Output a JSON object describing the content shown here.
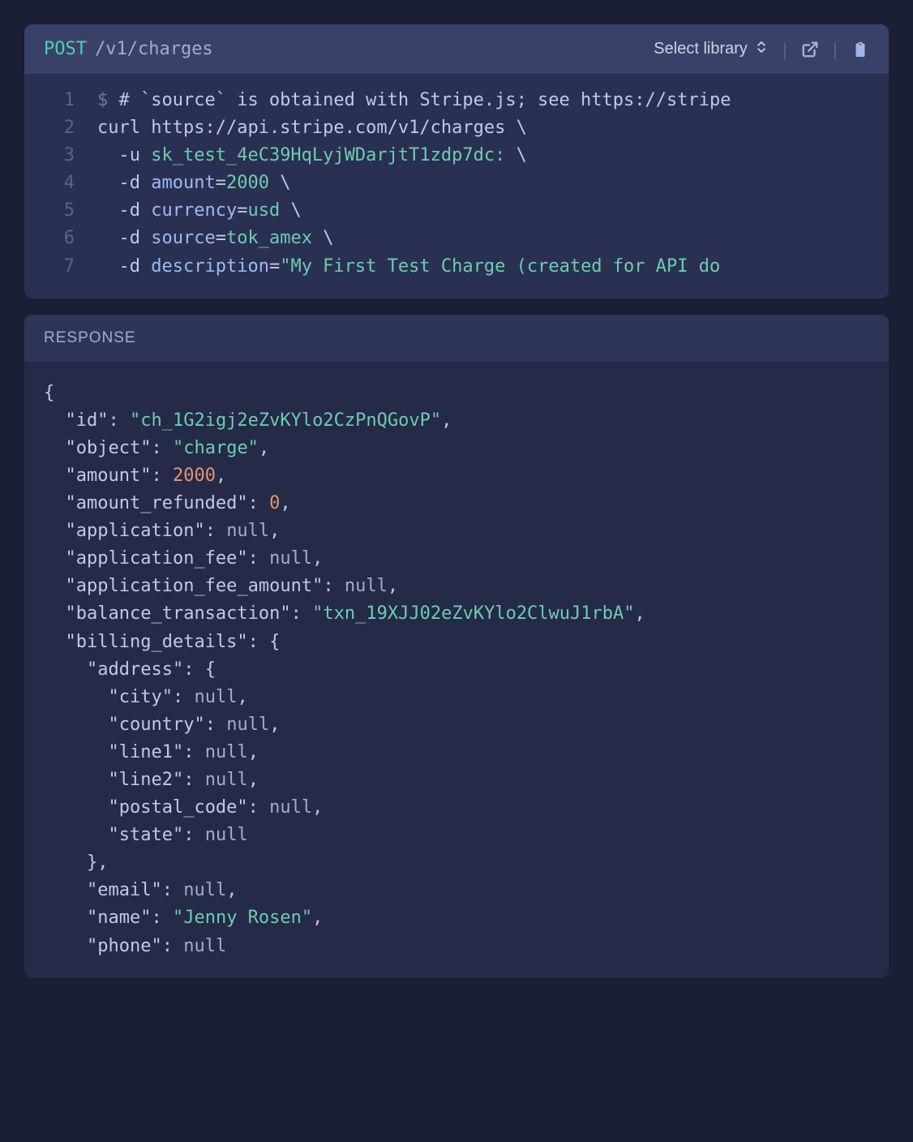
{
  "request": {
    "method": "POST",
    "path": "/v1/charges",
    "selectLibraryLabel": "Select library",
    "lines": [
      {
        "n": "1",
        "type": "comment",
        "prompt": "$",
        "text": "# `source` is obtained with Stripe.js; see https://stripe"
      },
      {
        "n": "2",
        "type": "curl",
        "cmd": "curl",
        "url": "https://api.stripe.com/v1/charges",
        "cont": true
      },
      {
        "n": "3",
        "type": "auth",
        "flag": "-u",
        "key": "sk_test_4eC39HqLyjWDarjtT1zdp7dc:",
        "cont": true
      },
      {
        "n": "4",
        "type": "data",
        "flag": "-d",
        "param": "amount",
        "val": "2000",
        "cont": true
      },
      {
        "n": "5",
        "type": "data",
        "flag": "-d",
        "param": "currency",
        "val": "usd",
        "cont": true
      },
      {
        "n": "6",
        "type": "data",
        "flag": "-d",
        "param": "source",
        "val": "tok_amex",
        "cont": true
      },
      {
        "n": "7",
        "type": "data-str",
        "flag": "-d",
        "param": "description",
        "val": "\"My First Test Charge (created for API do"
      }
    ]
  },
  "response": {
    "label": "RESPONSE",
    "json": {
      "id": "ch_1G2igj2eZvKYlo2CzPnQGovP",
      "object": "charge",
      "amount": 2000,
      "amount_refunded": 0,
      "application": null,
      "application_fee": null,
      "application_fee_amount": null,
      "balance_transaction": "txn_19XJJ02eZvKYlo2ClwuJ1rbA",
      "billing_details": {
        "address": {
          "city": null,
          "country": null,
          "line1": null,
          "line2": null,
          "postal_code": null,
          "state": null
        },
        "email": null,
        "name": "Jenny Rosen",
        "phone": null
      }
    }
  }
}
